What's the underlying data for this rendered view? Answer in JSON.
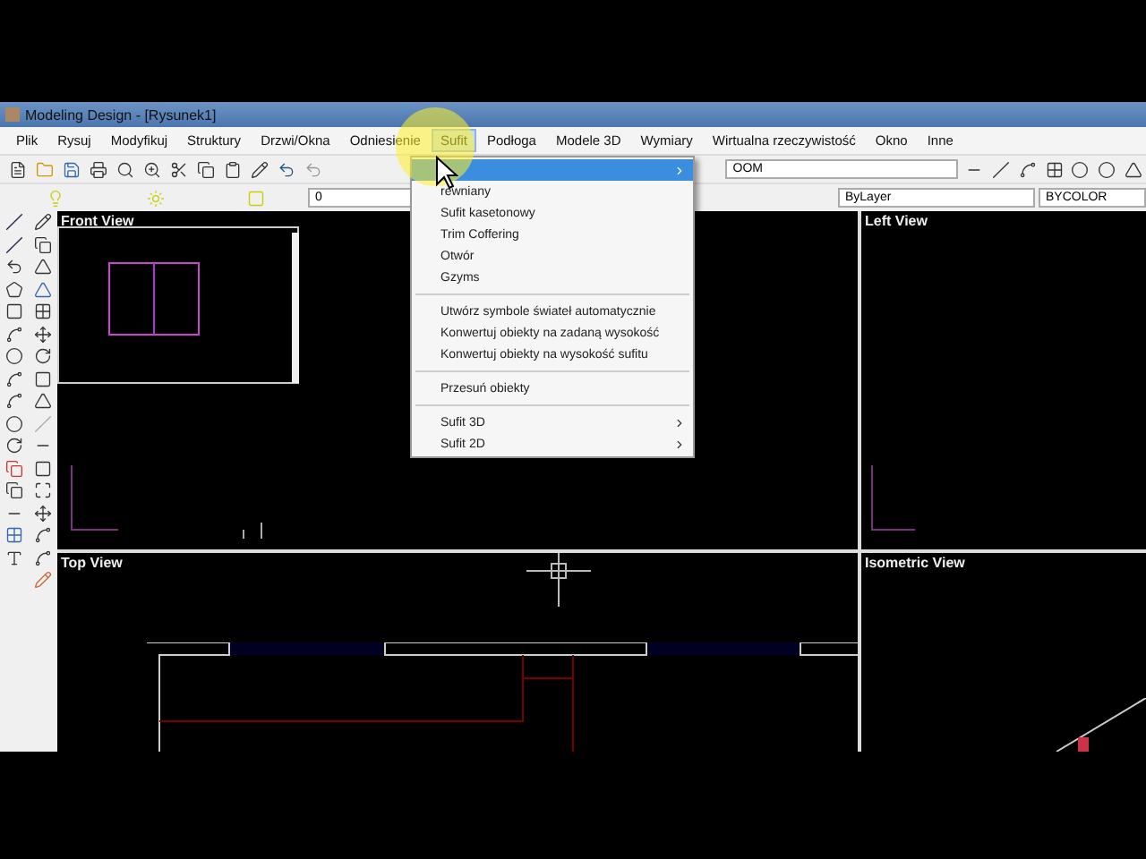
{
  "window": {
    "title": "Modeling Design - [Rysunek1]"
  },
  "menubar": [
    {
      "label": "Plik",
      "selected": false
    },
    {
      "label": "Rysuj",
      "selected": false
    },
    {
      "label": "Modyfikuj",
      "selected": false
    },
    {
      "label": "Struktury",
      "selected": false
    },
    {
      "label": "Drzwi/Okna",
      "selected": false
    },
    {
      "label": "Odniesienie",
      "selected": false
    },
    {
      "label": "Sufit",
      "selected": true
    },
    {
      "label": "Podłoga",
      "selected": false
    },
    {
      "label": "Modele 3D",
      "selected": false
    },
    {
      "label": "Wymiary",
      "selected": false
    },
    {
      "label": "Wirtualna rzeczywistość",
      "selected": false
    },
    {
      "label": "Okno",
      "selected": false
    },
    {
      "label": "Inne",
      "selected": false
    }
  ],
  "toolbar": {
    "layer_combo": "0",
    "view_combo": "OOM",
    "linetype_combo": "ByLayer",
    "color_combo": "BYCOLOR"
  },
  "dropdown_menu": [
    {
      "kind": "item",
      "selected": true,
      "submenu": true
    },
    {
      "kind": "item",
      "label": "rewniany",
      "selected": false,
      "submenu": false
    },
    {
      "kind": "item",
      "label": "Sufit kasetonowy",
      "selected": false,
      "submenu": false
    },
    {
      "kind": "item",
      "label": "Trim Coffering",
      "selected": false,
      "submenu": false
    },
    {
      "kind": "item",
      "label": "Otwór",
      "selected": false,
      "submenu": false
    },
    {
      "kind": "item",
      "label": "Gzyms",
      "selected": false,
      "submenu": false
    },
    {
      "kind": "separator"
    },
    {
      "kind": "item",
      "label": "Utwórz symbole świateł automatycznie",
      "selected": false,
      "submenu": false
    },
    {
      "kind": "item",
      "label": "Konwertuj obiekty na zadaną wysokość",
      "selected": false,
      "submenu": false
    },
    {
      "kind": "item",
      "label": "Konwertuj obiekty na wysokość sufitu",
      "selected": false,
      "submenu": false
    },
    {
      "kind": "separator"
    },
    {
      "kind": "item",
      "label": "Przesuń obiekty",
      "selected": false,
      "submenu": false
    },
    {
      "kind": "separator"
    },
    {
      "kind": "item",
      "label": "Sufit 3D",
      "selected": false,
      "submenu": true
    },
    {
      "kind": "item",
      "label": "Sufit 2D",
      "selected": false,
      "submenu": true
    }
  ],
  "viewports": [
    {
      "kind": "front",
      "title": "Front View"
    },
    {
      "kind": "left",
      "title": "Left View"
    },
    {
      "kind": "top",
      "title": "Top View"
    },
    {
      "kind": "iso",
      "title": "Isometric View"
    }
  ]
}
